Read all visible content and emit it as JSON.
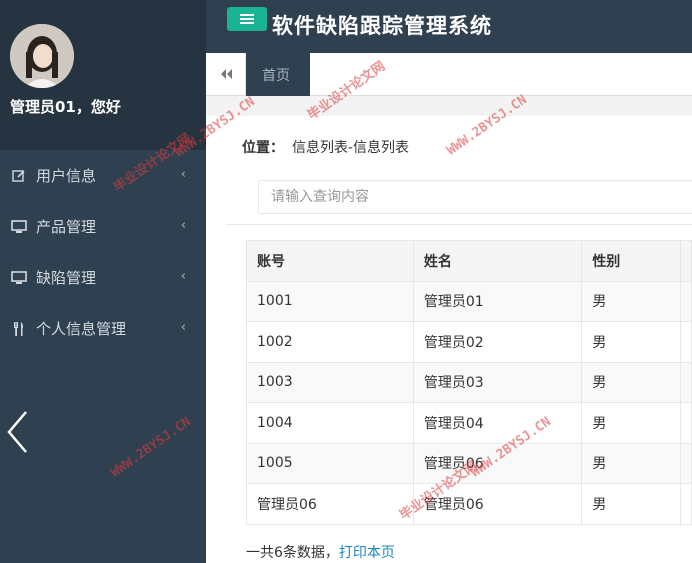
{
  "sidebar": {
    "greeting": "管理员01，您好",
    "items": [
      {
        "label": "用户信息",
        "icon": "edit-icon"
      },
      {
        "label": "产品管理",
        "icon": "desktop-icon"
      },
      {
        "label": "缺陷管理",
        "icon": "desktop-icon"
      },
      {
        "label": "个人信息管理",
        "icon": "cutlery-icon"
      }
    ]
  },
  "header": {
    "title": "软件缺陷跟踪管理系统",
    "accent": "#1ab394"
  },
  "tabs": {
    "home": "首页"
  },
  "main": {
    "breadcrumb_label": "位置：",
    "breadcrumb_path": "信息列表-信息列表",
    "search_placeholder": "请输入查询内容",
    "columns": [
      "账号",
      "姓名",
      "性别"
    ],
    "rows": [
      [
        "1001",
        "管理员01",
        "男"
      ],
      [
        "1002",
        "管理员02",
        "男"
      ],
      [
        "1003",
        "管理员03",
        "男"
      ],
      [
        "1004",
        "管理员04",
        "男"
      ],
      [
        "1005",
        "管理员06",
        "男"
      ],
      [
        "管理员06",
        "管理员06",
        "男"
      ]
    ],
    "footer_count": "一共6条数据，",
    "footer_print": "打印本页"
  },
  "watermarks": {
    "url": "WWW.2BYSJ.CN",
    "cn": "毕业设计论文网"
  }
}
